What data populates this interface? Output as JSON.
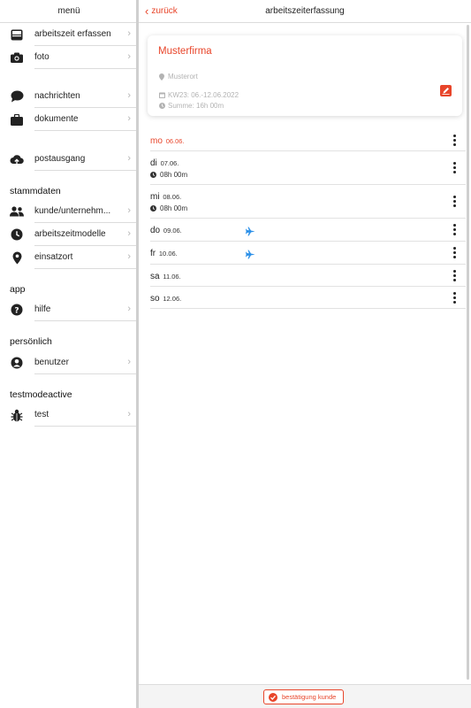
{
  "sidebar": {
    "title": "menü",
    "items": [
      {
        "label": "arbeitszeit erfassen",
        "icon": "inbox-icon"
      },
      {
        "label": "foto",
        "icon": "camera-icon"
      },
      {
        "label": "nachrichten",
        "icon": "chat-icon"
      },
      {
        "label": "dokumente",
        "icon": "briefcase-icon"
      },
      {
        "label": "postausgang",
        "icon": "cloud-upload-icon"
      }
    ],
    "sections": [
      {
        "title": "stammdaten",
        "items": [
          {
            "label": "kunde/unternehm...",
            "icon": "users-icon"
          },
          {
            "label": "arbeitszeitmodelle",
            "icon": "clock-icon"
          },
          {
            "label": "einsatzort",
            "icon": "location-pin-icon"
          }
        ]
      },
      {
        "title": "app",
        "items": [
          {
            "label": "hilfe",
            "icon": "help-icon"
          }
        ]
      },
      {
        "title": "persönlich",
        "items": [
          {
            "label": "benutzer",
            "icon": "user-circle-icon"
          }
        ]
      },
      {
        "title": "testmodeactive",
        "items": [
          {
            "label": "test",
            "icon": "bug-icon"
          }
        ]
      }
    ]
  },
  "main": {
    "back_label": "zurück",
    "title": "arbeitszeiterfassung",
    "card": {
      "company": "Musterfirma",
      "location": "Musterort",
      "week": "KW23: 06.-12.06.2022",
      "sum": "Summe: 16h 00m"
    },
    "days": [
      {
        "day": "mo",
        "date": "06.06.",
        "duration": "",
        "today": true,
        "travel": false
      },
      {
        "day": "di",
        "date": "07.06.",
        "duration": "08h 00m",
        "today": false,
        "travel": false
      },
      {
        "day": "mi",
        "date": "08.06.",
        "duration": "08h 00m",
        "today": false,
        "travel": false
      },
      {
        "day": "do",
        "date": "09.06.",
        "duration": "",
        "today": false,
        "travel": true
      },
      {
        "day": "fr",
        "date": "10.06.",
        "duration": "",
        "today": false,
        "travel": true
      },
      {
        "day": "sa",
        "date": "11.06.",
        "duration": "",
        "today": false,
        "travel": false
      },
      {
        "day": "so",
        "date": "12.06.",
        "duration": "",
        "today": false,
        "travel": false
      }
    ],
    "confirm_label": "bestätigung kunde"
  },
  "colors": {
    "accent": "#e8452a",
    "travel": "#2a8fe8",
    "muted": "#b3b3b3"
  }
}
